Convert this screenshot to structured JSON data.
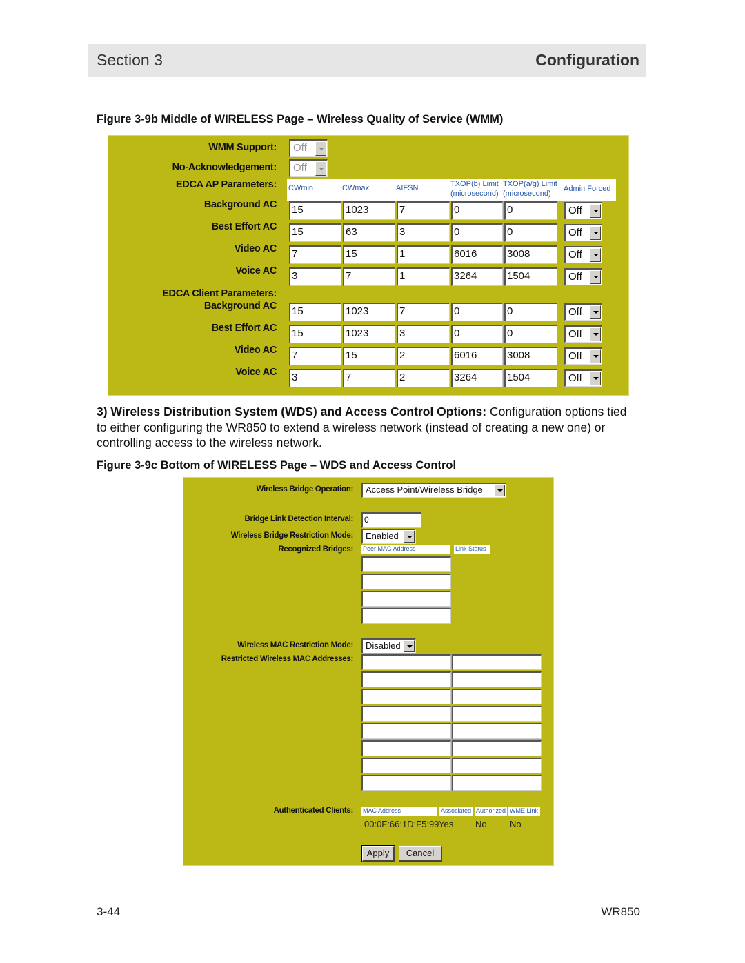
{
  "header": {
    "section": "Section 3",
    "title": "Configuration"
  },
  "figure_b": {
    "caption": "Figure 3-9b   Middle of WIRELESS Page – Wireless Quality of Service (WMM)",
    "wmm_support": {
      "label": "WMM Support:",
      "value": "Off"
    },
    "no_ack": {
      "label": "No-Acknowledgement:",
      "value": "Off"
    },
    "edca_ap_label": "EDCA AP Parameters:",
    "edca_client_label": "EDCA Client Parameters:",
    "columns": {
      "cwmin": "CWmin",
      "cwmax": "CWmax",
      "aifsn": "AIFSN",
      "txop_b": "TXOP(b) Limit",
      "txop_ag": "TXOP(a/g) Limit",
      "unit_b": "(microsecond)",
      "unit_ag": "(microsecond)",
      "admin_forced": "Admin Forced"
    },
    "ap_rows": [
      {
        "label": "Background AC",
        "cwmin": "15",
        "cwmax": "1023",
        "aifsn": "7",
        "txop_b": "0",
        "txop_ag": "0",
        "admin": "Off"
      },
      {
        "label": "Best Effort AC",
        "cwmin": "15",
        "cwmax": "63",
        "aifsn": "3",
        "txop_b": "0",
        "txop_ag": "0",
        "admin": "Off"
      },
      {
        "label": "Video AC",
        "cwmin": "7",
        "cwmax": "15",
        "aifsn": "1",
        "txop_b": "6016",
        "txop_ag": "3008",
        "admin": "Off"
      },
      {
        "label": "Voice AC",
        "cwmin": "3",
        "cwmax": "7",
        "aifsn": "1",
        "txop_b": "3264",
        "txop_ag": "1504",
        "admin": "Off"
      }
    ],
    "client_rows": [
      {
        "label": "Background AC",
        "cwmin": "15",
        "cwmax": "1023",
        "aifsn": "7",
        "txop_b": "0",
        "txop_ag": "0",
        "admin": "Off"
      },
      {
        "label": "Best Effort AC",
        "cwmin": "15",
        "cwmax": "1023",
        "aifsn": "3",
        "txop_b": "0",
        "txop_ag": "0",
        "admin": "Off"
      },
      {
        "label": "Video AC",
        "cwmin": "7",
        "cwmax": "15",
        "aifsn": "2",
        "txop_b": "6016",
        "txop_ag": "3008",
        "admin": "Off"
      },
      {
        "label": "Voice AC",
        "cwmin": "3",
        "cwmax": "7",
        "aifsn": "2",
        "txop_b": "3264",
        "txop_ag": "1504",
        "admin": "Off"
      }
    ]
  },
  "paragraph": {
    "heading": "3) Wireless Distribution System (WDS) and Access Control Options:",
    "body": " Configuration options tied to either configuring the WR850 to extend a wireless network (instead of creating a new one) or controlling access to the wireless network."
  },
  "figure_c": {
    "caption": "Figure 3-9c   Bottom of WIRELESS Page – WDS and Access Control",
    "bridge_operation": {
      "label": "Wireless Bridge Operation:",
      "value": "Access Point/Wireless Bridge"
    },
    "link_interval": {
      "label": "Bridge Link Detection Interval:",
      "value": "0"
    },
    "bridge_restriction": {
      "label": "Wireless Bridge Restriction Mode:",
      "value": "Enabled"
    },
    "recognized_bridges": {
      "label": "Recognized Bridges:",
      "col_mac": "Peer MAC Address",
      "col_status": "Link Status",
      "entries": [
        "",
        "",
        "",
        ""
      ]
    },
    "mac_restriction": {
      "label": "Wireless MAC Restriction Mode:",
      "value": "Disabled"
    },
    "restricted_macs": {
      "label": "Restricted Wireless MAC Addresses:",
      "entries": [
        "",
        "",
        "",
        "",
        "",
        "",
        "",
        "",
        "",
        "",
        "",
        "",
        "",
        "",
        "",
        ""
      ]
    },
    "authenticated_clients": {
      "label": "Authenticated Clients:",
      "columns": [
        "MAC Address",
        "Associated",
        "Authorized",
        "WME Link"
      ],
      "rows": [
        {
          "mac": "00:0F:66:1D:F5:99",
          "associated": "Yes",
          "authorized": "No",
          "wme_link": "No"
        }
      ]
    },
    "buttons": {
      "apply": "Apply",
      "cancel": "Cancel"
    }
  },
  "footer": {
    "page": "3-44",
    "model": "WR850"
  }
}
